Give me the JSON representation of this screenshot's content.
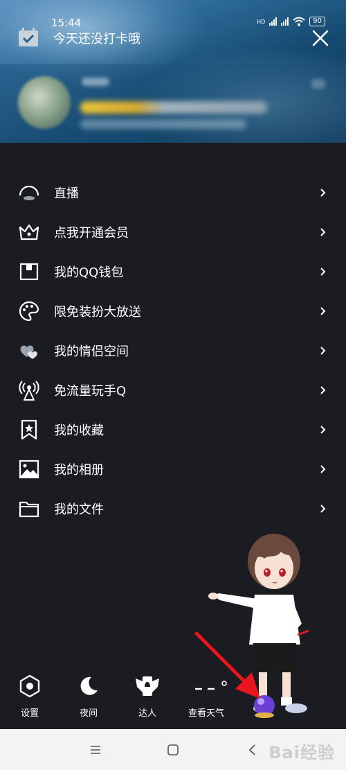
{
  "status_bar": {
    "time": "15:44",
    "hd": "HD",
    "battery": "90"
  },
  "header": {
    "checkin_text": "今天还没打卡哦"
  },
  "menu": {
    "items": [
      {
        "label": "直播",
        "icon": "live-icon"
      },
      {
        "label": "点我开通会员",
        "icon": "crown-icon"
      },
      {
        "label": "我的QQ钱包",
        "icon": "wallet-icon"
      },
      {
        "label": "限免装扮大放送",
        "icon": "palette-icon"
      },
      {
        "label": "我的情侣空间",
        "icon": "hearts-icon"
      },
      {
        "label": "免流量玩手Q",
        "icon": "signal-tower-icon"
      },
      {
        "label": "我的收藏",
        "icon": "bookmark-star-icon"
      },
      {
        "label": "我的相册",
        "icon": "photo-icon"
      },
      {
        "label": "我的文件",
        "icon": "folder-icon"
      }
    ]
  },
  "bottom": {
    "settings": "设置",
    "night": "夜间",
    "daren": "达人",
    "weather": "查看天气"
  },
  "watermark": "Bai经验",
  "colors": {
    "background": "#1a1c21",
    "header_blue": "#14496f",
    "arrow_red": "#e8141e",
    "navbar": "#f3f3f3"
  }
}
